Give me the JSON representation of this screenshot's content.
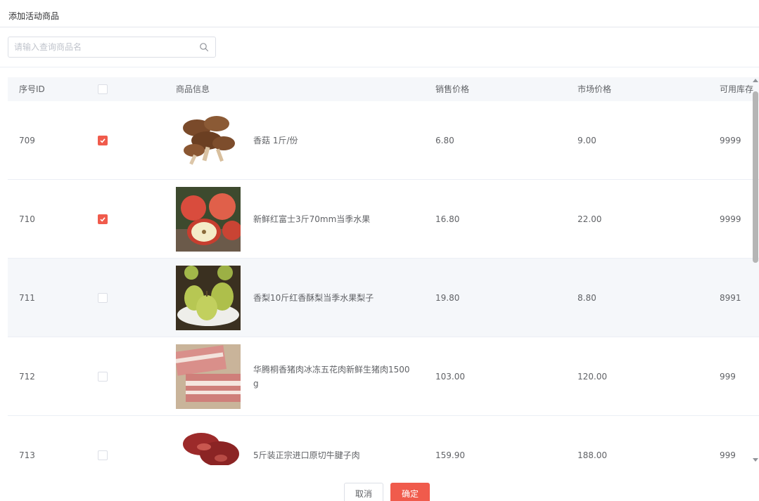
{
  "dialog": {
    "title": "添加活动商品"
  },
  "search": {
    "placeholder": "请输入查询商品名",
    "value": "",
    "icon": "search-icon"
  },
  "table": {
    "columns": {
      "id": "序号ID",
      "info": "商品信息",
      "sale_price": "销售价格",
      "market_price": "市场价格",
      "stock": "可用库存"
    },
    "rows": [
      {
        "id": "709",
        "checked": true,
        "image": "mushroom",
        "name": "香菇 1斤/份",
        "sale_price": "6.80",
        "market_price": "9.00",
        "stock": "9999",
        "highlighted": false
      },
      {
        "id": "710",
        "checked": true,
        "image": "apple",
        "name": "新鲜红富士3斤70mm当季水果",
        "sale_price": "16.80",
        "market_price": "22.00",
        "stock": "9999",
        "highlighted": false
      },
      {
        "id": "711",
        "checked": false,
        "image": "pear",
        "name": "香梨10斤红香酥梨当季水果梨子",
        "sale_price": "19.80",
        "market_price": "8.80",
        "stock": "8991",
        "highlighted": true
      },
      {
        "id": "712",
        "checked": false,
        "image": "pork",
        "name": "华腾桐香猪肉冰冻五花肉新鲜生猪肉1500g",
        "sale_price": "103.00",
        "market_price": "120.00",
        "stock": "999",
        "highlighted": false
      },
      {
        "id": "713",
        "checked": false,
        "image": "beef",
        "name": "5斤装正宗进口原切牛腱子肉",
        "sale_price": "159.90",
        "market_price": "188.00",
        "stock": "999",
        "highlighted": false
      }
    ]
  },
  "footer": {
    "cancel_label": "取消",
    "confirm_label": "确定"
  },
  "colors": {
    "accent": "#f05b4c",
    "header_bg": "#f5f7fa",
    "border": "#dcdfe6"
  }
}
